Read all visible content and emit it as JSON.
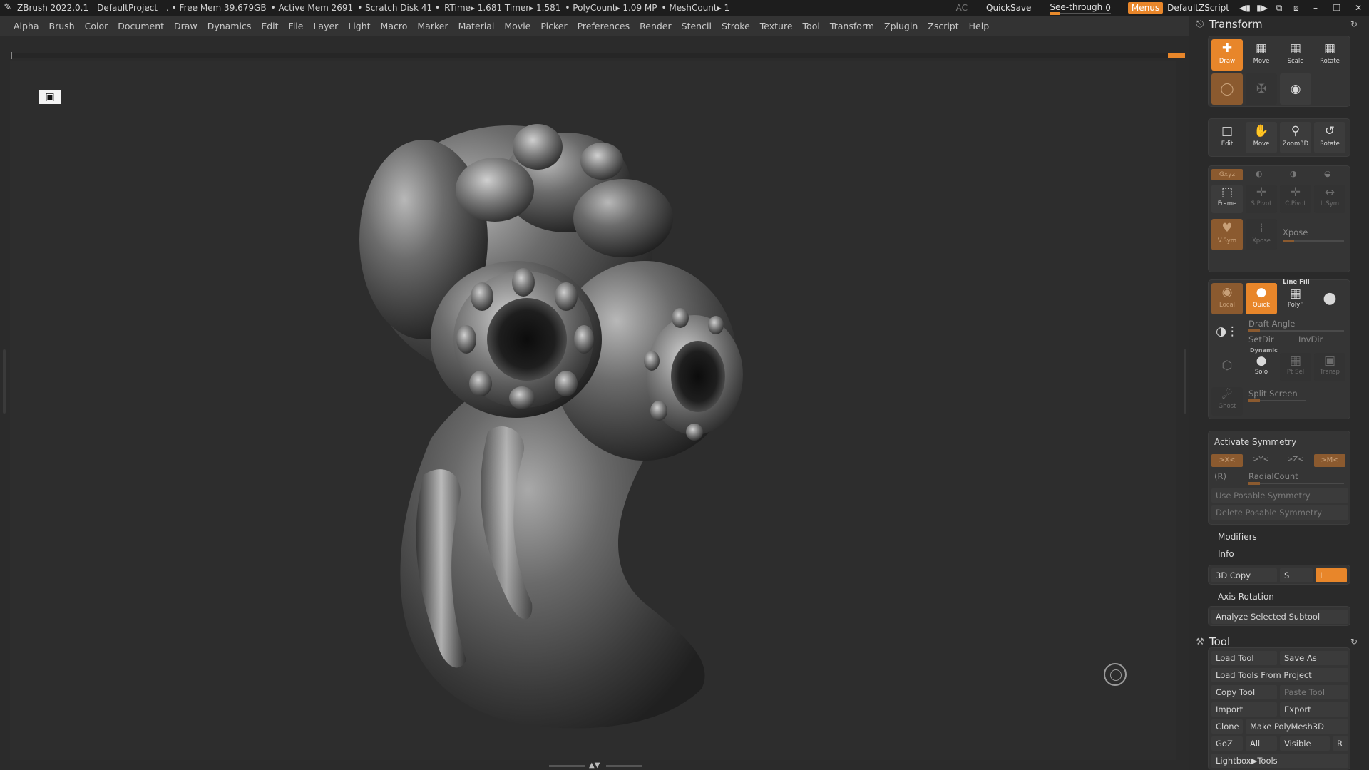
{
  "titlebar": {
    "app": "ZBrush 2022.0.1",
    "project": "DefaultProject",
    "stats": [
      ". • Free Mem 39.679GB",
      "• Active Mem 2691",
      "• Scratch Disk 41 •",
      "RTime▸ 1.681 Timer▸ 1.581",
      "• PolyCount▸ 1.09 MP",
      "• MeshCount▸ 1"
    ],
    "ac": "AC",
    "quicksave": "QuickSave",
    "see_through_label": "See-through",
    "see_through_value": "0",
    "menus": "Menus",
    "script": "DefaultZScript"
  },
  "menubar": [
    "Alpha",
    "Brush",
    "Color",
    "Document",
    "Draw",
    "Dynamics",
    "Edit",
    "File",
    "Layer",
    "Light",
    "Macro",
    "Marker",
    "Material",
    "Movie",
    "Picker",
    "Preferences",
    "Render",
    "Stencil",
    "Stroke",
    "Texture",
    "Tool",
    "Transform",
    "Zplugin",
    "Zscript",
    "Help"
  ],
  "transform": {
    "title": "Transform",
    "row1": {
      "draw": "Draw",
      "move": "Move",
      "scale": "Scale",
      "rotate": "Rotate"
    },
    "row3": {
      "edit": "Edit",
      "move": "Move",
      "zoom3d": "Zoom3D",
      "rotate": "Rotate"
    },
    "xyz": "Gxyz",
    "frame": "Frame",
    "spivot": "S.Pivot",
    "cpivot": "C.Pivot",
    "lsym": "L.Sym",
    "vsym": "V.Sym",
    "xpose_btn": "Xpose",
    "xpose_label": "Xpose",
    "local": "Local",
    "quick": "Quick",
    "line_fill": "Line Fill",
    "polyf": "PolyF",
    "draft_angle": "Draft Angle",
    "setdir": "SetDir",
    "invdir": "InvDir",
    "dynamic": "Dynamic",
    "solo": "Solo",
    "ptsel": "Pt Sel",
    "transp": "Transp",
    "split_screen": "Split Screen",
    "ghost": "Ghost",
    "activate_symmetry": "Activate Symmetry",
    "sym_x": ">X<",
    "sym_y": ">Y<",
    "sym_z": ">Z<",
    "sym_m": ">M<",
    "sym_r": "(R)",
    "radial_count": "RadialCount",
    "use_posable": "Use Posable Symmetry",
    "delete_posable": "Delete Posable Symmetry",
    "modifiers": "Modifiers",
    "info": "Info",
    "copy3d": "3D Copy",
    "copy3d_s": "S",
    "copy3d_i": "I",
    "axis_rotation": "Axis Rotation",
    "analyze": "Analyze Selected Subtool"
  },
  "tool": {
    "title": "Tool",
    "load_tool": "Load Tool",
    "save_as": "Save As",
    "load_from_project": "Load Tools From Project",
    "copy_tool": "Copy Tool",
    "paste_tool": "Paste Tool",
    "import": "Import",
    "export": "Export",
    "clone": "Clone",
    "make_polymesh": "Make PolyMesh3D",
    "goz": "GoZ",
    "all": "All",
    "visible": "Visible",
    "r": "R",
    "lightbox_tools": "Lightbox▶Tools"
  },
  "colors": {
    "accent": "#e8862a",
    "panel": "#353535",
    "viewport": "#2d2d2d"
  }
}
